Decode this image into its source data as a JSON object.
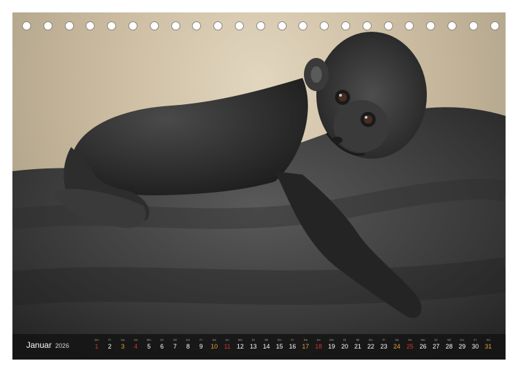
{
  "calendar": {
    "month": "Januar",
    "year": "2026",
    "days": [
      {
        "wd": "Do",
        "n": "1",
        "type": "hol"
      },
      {
        "wd": "Fr",
        "n": "2",
        "type": "wk"
      },
      {
        "wd": "Sa",
        "n": "3",
        "type": "sat"
      },
      {
        "wd": "So",
        "n": "4",
        "type": "sun"
      },
      {
        "wd": "Mo",
        "n": "5",
        "type": "wk"
      },
      {
        "wd": "Di",
        "n": "6",
        "type": "wk"
      },
      {
        "wd": "Mi",
        "n": "7",
        "type": "wk"
      },
      {
        "wd": "Do",
        "n": "8",
        "type": "wk"
      },
      {
        "wd": "Fr",
        "n": "9",
        "type": "wk"
      },
      {
        "wd": "Sa",
        "n": "10",
        "type": "sat"
      },
      {
        "wd": "So",
        "n": "11",
        "type": "sun"
      },
      {
        "wd": "Mo",
        "n": "12",
        "type": "wk"
      },
      {
        "wd": "Di",
        "n": "13",
        "type": "wk"
      },
      {
        "wd": "Mi",
        "n": "14",
        "type": "wk"
      },
      {
        "wd": "Do",
        "n": "15",
        "type": "wk"
      },
      {
        "wd": "Fr",
        "n": "16",
        "type": "wk"
      },
      {
        "wd": "Sa",
        "n": "17",
        "type": "sat"
      },
      {
        "wd": "So",
        "n": "18",
        "type": "sun"
      },
      {
        "wd": "Mo",
        "n": "19",
        "type": "wk"
      },
      {
        "wd": "Di",
        "n": "20",
        "type": "wk"
      },
      {
        "wd": "Mi",
        "n": "21",
        "type": "wk"
      },
      {
        "wd": "Do",
        "n": "22",
        "type": "wk"
      },
      {
        "wd": "Fr",
        "n": "23",
        "type": "wk"
      },
      {
        "wd": "Sa",
        "n": "24",
        "type": "sat"
      },
      {
        "wd": "So",
        "n": "25",
        "type": "sun"
      },
      {
        "wd": "Mo",
        "n": "26",
        "type": "wk"
      },
      {
        "wd": "Di",
        "n": "27",
        "type": "wk"
      },
      {
        "wd": "Mi",
        "n": "28",
        "type": "wk"
      },
      {
        "wd": "Do",
        "n": "29",
        "type": "wk"
      },
      {
        "wd": "Fr",
        "n": "30",
        "type": "wk"
      },
      {
        "wd": "Sa",
        "n": "31",
        "type": "sat"
      }
    ]
  },
  "binding_holes": 23,
  "colors": {
    "saturday": "#e8a23a",
    "sunday": "#d0392b",
    "bar": "#141414"
  }
}
